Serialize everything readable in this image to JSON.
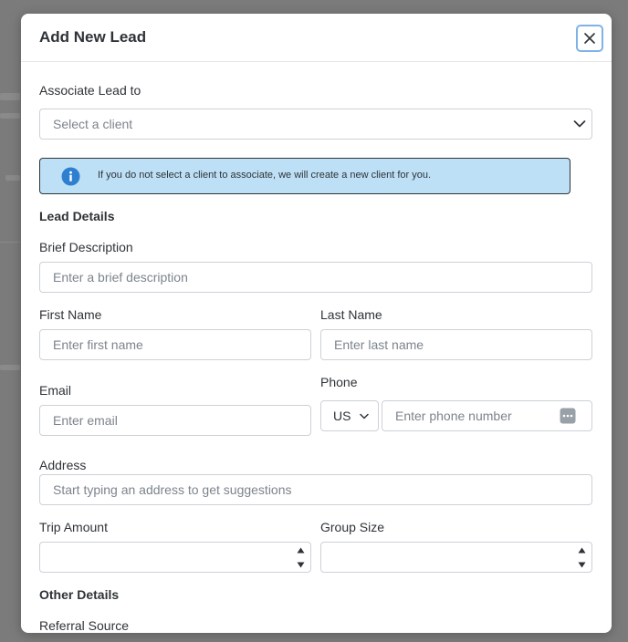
{
  "modal": {
    "title": "Add New Lead"
  },
  "associate": {
    "label": "Associate Lead to",
    "placeholder": "Select a client"
  },
  "info": {
    "text": "If you do not select a client to associate, we will create a new client for you."
  },
  "lead_details": {
    "section_title": "Lead Details",
    "brief_label": "Brief Description",
    "brief_placeholder": "Enter a brief description",
    "first_name_label": "First Name",
    "first_name_placeholder": "Enter first name",
    "last_name_label": "Last Name",
    "last_name_placeholder": "Enter last name",
    "email_label": "Email",
    "email_placeholder": "Enter email",
    "phone_label": "Phone",
    "phone_country": "US",
    "phone_placeholder": "Enter phone number",
    "address_label": "Address",
    "address_placeholder": "Start typing an address to get suggestions",
    "trip_amount_label": "Trip Amount",
    "group_size_label": "Group Size"
  },
  "other_details": {
    "section_title": "Other Details",
    "referral_label": "Referral Source"
  },
  "icons": {
    "close": "close-icon",
    "info": "info-circle-icon",
    "chevron": "chevron-down-icon",
    "password_manager": "password-manager-icon",
    "spin_up": "triangle-up-icon",
    "spin_down": "triangle-down-icon"
  },
  "colors": {
    "info_background": "#bde0f6",
    "info_icon": "#2f7fd0",
    "focus_border": "#7fb3e6"
  }
}
